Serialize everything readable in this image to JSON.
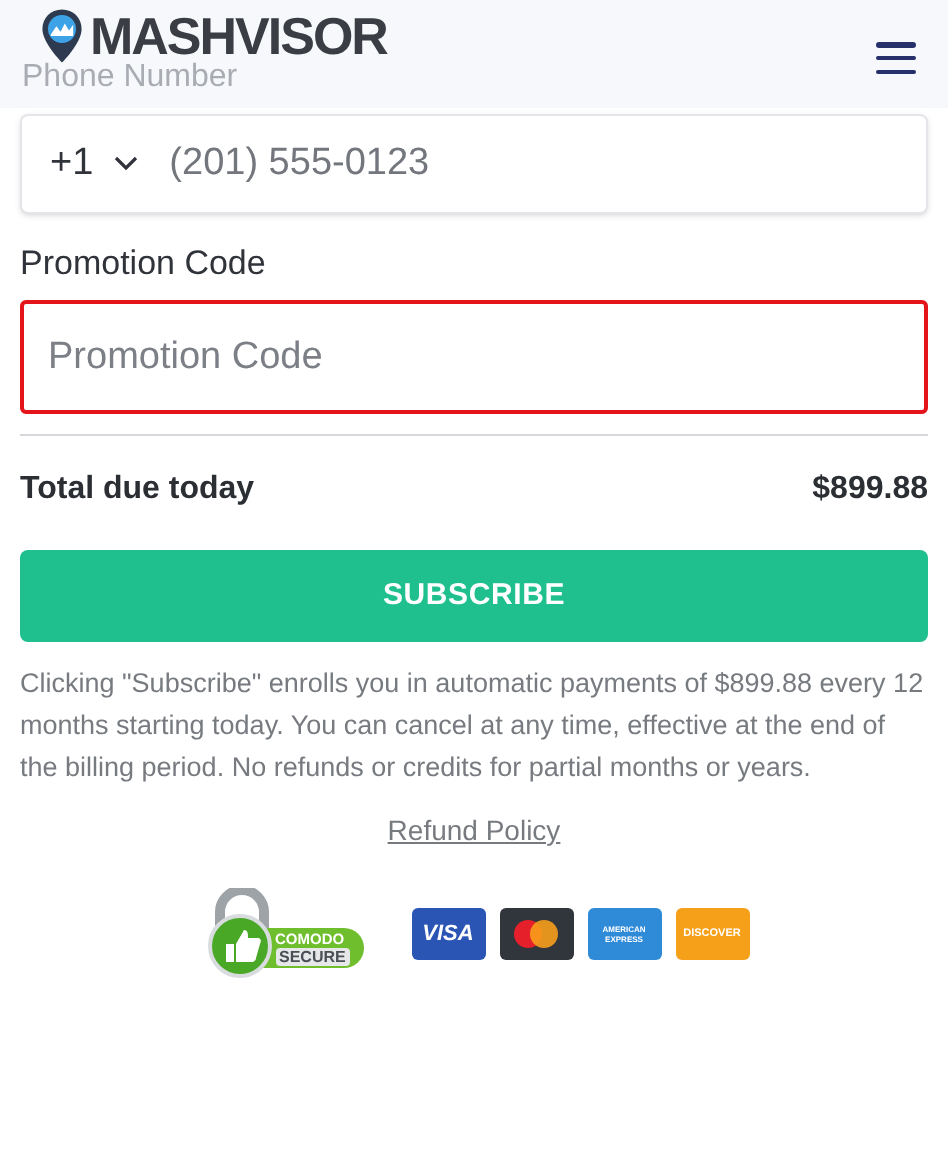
{
  "header": {
    "logo_text": "MASHVISOR"
  },
  "phone": {
    "label": "Phone Number",
    "country_code": "+1",
    "placeholder": "(201) 555-0123"
  },
  "promotion": {
    "label": "Promotion Code",
    "placeholder": "Promotion Code",
    "highlighted": true
  },
  "total": {
    "label": "Total due today",
    "amount": "$899.88"
  },
  "subscribe_button": "SUBSCRIBE",
  "terms": "Clicking \"Subscribe\" enrolls you in automatic payments of $899.88 every 12 months starting today. You can cancel at any time, effective at the end of the billing period. No refunds or credits for partial months or years.",
  "refund_link": "Refund Policy",
  "secure_badge": {
    "line_1": "COMODO",
    "line_2": "SECURE"
  },
  "cards": [
    {
      "kind": "visa",
      "label": "VISA"
    },
    {
      "kind": "mastercard"
    },
    {
      "kind": "amex",
      "label": "AMERICAN EXPRESS"
    },
    {
      "kind": "discover",
      "label": "DISCOVER"
    }
  ]
}
